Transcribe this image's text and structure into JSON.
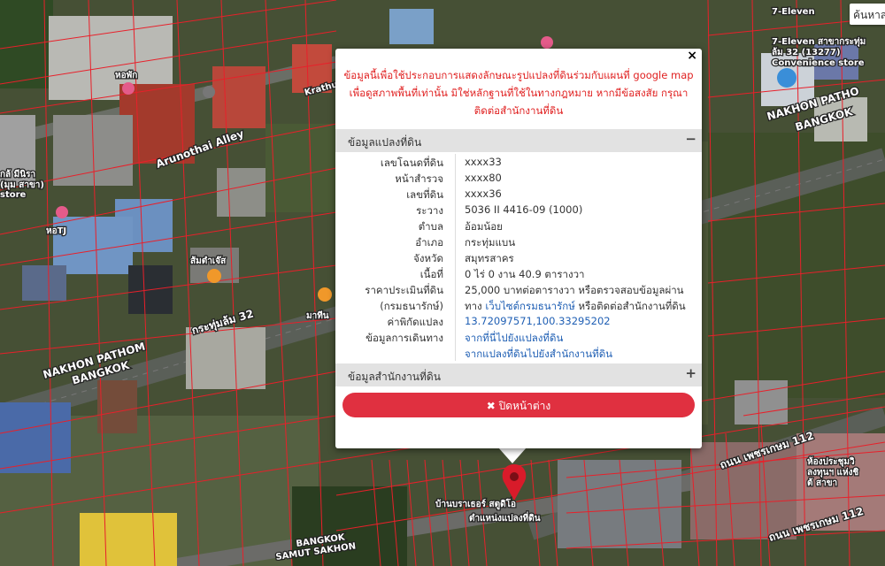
{
  "map": {
    "search_label": "ค้นหาส",
    "labels": {
      "krathum": "Krathum L",
      "arunothai": "Arunothai Alley",
      "nakhon_pathom_left": "NAKHON PATHOM",
      "bangkok_left": "BANGKOK",
      "kratumlom32": "กระทุ่มล้ม 32",
      "nakhon_pathom_right": "NAKHON PATHO",
      "bangkok_right": "BANGKOK",
      "phetkasem_1": "ถนน เพชรเกษม 112",
      "phetkasem_2": "ถนน เพชรเกษม 112",
      "bangkok_bottom": "BANGKOK",
      "samut_sakhon": "SAMUT SAKHON",
      "seven_eleven": "7-Eleven",
      "seven_eleven_sub": "7-Eleven สาขากระทุ่ม",
      "seven_eleven_sub2": "ล้ม 32 (13277)",
      "convenience": "Convenience store",
      "hopak": "หอพัก",
      "hotj": "หอTJ",
      "somtam": "ส้มตำเจ๊ส",
      "clinic": "กล้ มีนิรา",
      "clinic2": "(มุม สาขา)",
      "store": "store",
      "mathin": "มาทีน",
      "apartment": "บ้านบราเธอร์ สตูดิโอ",
      "land_position": "ตำแหน่งแปลงที่ดิน",
      "thai_right": "ห้องประชุมวิ",
      "thai_right2": "ลงทุนฯ แห่งชิ",
      "thai_right3": "ต้ สาขา"
    }
  },
  "popup": {
    "close_symbol": "×",
    "disclaimer": "ข้อมูลนี้เพื่อใช้ประกอบการแสดงลักษณะรูปแปลงที่ดินร่วมกับแผนที่ google map เพื่อดูสภาพพื้นที่เท่านั้น มิใช่หลักฐานที่ใช้ในทางกฎหมาย หากมีข้อสงสัย กรุณาติดต่อสำนักงานที่ดิน",
    "section1": {
      "title": "ข้อมูลแปลงที่ดิน",
      "toggle": "−"
    },
    "rows": [
      {
        "label": "เลขโฉนดที่ดิน",
        "value": "xxxx33"
      },
      {
        "label": "หน้าสำรวจ",
        "value": "xxxx80"
      },
      {
        "label": "เลขที่ดิน",
        "value": "xxxx36"
      },
      {
        "label": "ระวาง",
        "value": "5036 II 4416-09 (1000)"
      },
      {
        "label": "ตำบล",
        "value": "อ้อมน้อย"
      },
      {
        "label": "อำเภอ",
        "value": "กระทุ่มแบน"
      },
      {
        "label": "จังหวัด",
        "value": "สมุทรสาคร"
      },
      {
        "label": "เนื้อที่",
        "value": "0 ไร่ 0 งาน 40.9 ตารางวา"
      }
    ],
    "price": {
      "label_line1": "ราคาประเมินที่ดิน",
      "label_line2": "(กรมธนารักษ์)",
      "value_line1": "25,000 บาทต่อตารางวา หรือตรวจสอบข้อมูลผ่าน",
      "value_line2_pre": "ทาง ",
      "value_line2_link": "เว็บไซต์กรมธนารักษ์",
      "value_line2_post": " หรือติดต่อสำนักงานที่ดิน"
    },
    "coords": {
      "label": "ค่าพิกัดแปลง",
      "value": "13.72097571,100.33295202"
    },
    "travel": {
      "label": "ข้อมูลการเดินทาง",
      "link1": "จากที่นี่ไปยังแปลงที่ดิน",
      "link2": "จากแปลงที่ดินไปยังสำนักงานที่ดิน"
    },
    "section2": {
      "title": "ข้อมูลสำนักงานที่ดิน",
      "toggle": "+"
    },
    "close_button": "✖ ปิดหน้าต่าง"
  },
  "colors": {
    "parcel_line": "#e8202a",
    "disclaimer": "#e02020",
    "close_button": "#e03040",
    "link": "#1f5fb4",
    "pin": "#d81b2a"
  }
}
